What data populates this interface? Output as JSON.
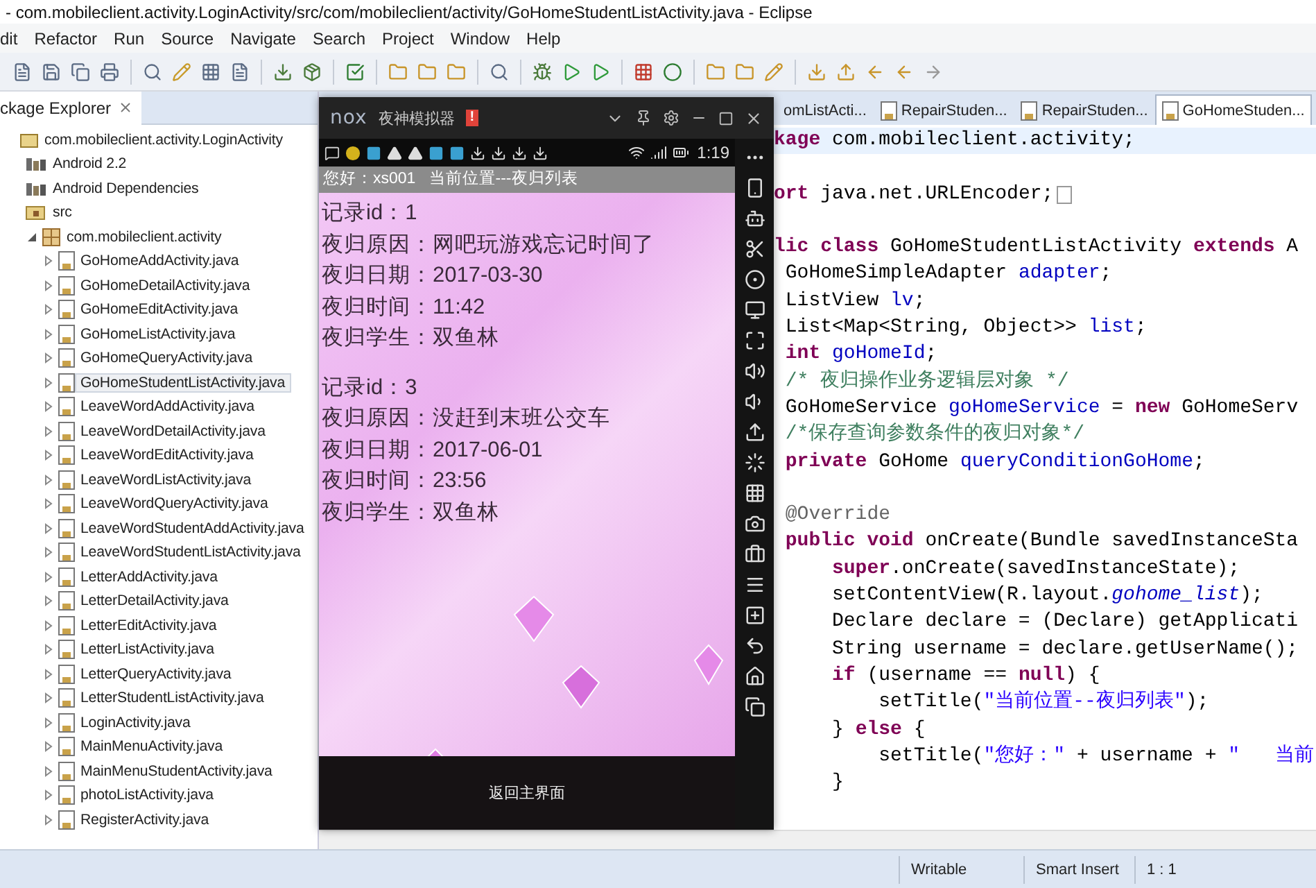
{
  "window": {
    "title": "- com.mobileclient.activity.LoginActivity/src/com/mobileclient/activity/GoHomeStudentListActivity.java - Eclipse"
  },
  "menu": [
    "dit",
    "Refactor",
    "Run",
    "Source",
    "Navigate",
    "Search",
    "Project",
    "Window",
    "Help"
  ],
  "package_explorer": {
    "title": "ckage Explorer",
    "tree": [
      {
        "label": "com.mobileclient.activity.LoginActivity",
        "kind": "project",
        "selected": false,
        "children": [
          {
            "label": "Android 2.2",
            "kind": "library",
            "selected": false
          },
          {
            "label": "Android Dependencies",
            "kind": "library",
            "selected": false
          },
          {
            "label": "src",
            "kind": "folder",
            "selected": false,
            "children": [
              {
                "label": "com.mobileclient.activity",
                "kind": "package",
                "expanded": true,
                "selected": false,
                "children": [
                  {
                    "label": "GoHomeAddActivity.java",
                    "kind": "file",
                    "expanded": false,
                    "selected": false
                  },
                  {
                    "label": "GoHomeDetailActivity.java",
                    "kind": "file",
                    "expanded": false,
                    "selected": false
                  },
                  {
                    "label": "GoHomeEditActivity.java",
                    "kind": "file",
                    "expanded": false,
                    "selected": false
                  },
                  {
                    "label": "GoHomeListActivity.java",
                    "kind": "file",
                    "expanded": false,
                    "selected": false
                  },
                  {
                    "label": "GoHomeQueryActivity.java",
                    "kind": "file",
                    "expanded": false,
                    "selected": false
                  },
                  {
                    "label": "GoHomeStudentListActivity.java",
                    "kind": "file",
                    "expanded": false,
                    "selected": true
                  },
                  {
                    "label": "LeaveWordAddActivity.java",
                    "kind": "file",
                    "expanded": false,
                    "selected": false
                  },
                  {
                    "label": "LeaveWordDetailActivity.java",
                    "kind": "file",
                    "expanded": false,
                    "selected": false
                  },
                  {
                    "label": "LeaveWordEditActivity.java",
                    "kind": "file",
                    "expanded": false,
                    "selected": false
                  },
                  {
                    "label": "LeaveWordListActivity.java",
                    "kind": "file",
                    "expanded": false,
                    "selected": false
                  },
                  {
                    "label": "LeaveWordQueryActivity.java",
                    "kind": "file",
                    "expanded": false,
                    "selected": false
                  },
                  {
                    "label": "LeaveWordStudentAddActivity.java",
                    "kind": "file",
                    "expanded": false,
                    "selected": false
                  },
                  {
                    "label": "LeaveWordStudentListActivity.java",
                    "kind": "file",
                    "expanded": false,
                    "selected": false
                  },
                  {
                    "label": "LetterAddActivity.java",
                    "kind": "file",
                    "expanded": false,
                    "selected": false
                  },
                  {
                    "label": "LetterDetailActivity.java",
                    "kind": "file",
                    "expanded": false,
                    "selected": false
                  },
                  {
                    "label": "LetterEditActivity.java",
                    "kind": "file",
                    "expanded": false,
                    "selected": false
                  },
                  {
                    "label": "LetterListActivity.java",
                    "kind": "file",
                    "expanded": false,
                    "selected": false
                  },
                  {
                    "label": "LetterQueryActivity.java",
                    "kind": "file",
                    "expanded": false,
                    "selected": false
                  },
                  {
                    "label": "LetterStudentListActivity.java",
                    "kind": "file",
                    "expanded": false,
                    "selected": false
                  },
                  {
                    "label": "LoginActivity.java",
                    "kind": "file",
                    "expanded": false,
                    "selected": false
                  },
                  {
                    "label": "MainMenuActivity.java",
                    "kind": "file",
                    "expanded": false,
                    "selected": false
                  },
                  {
                    "label": "MainMenuStudentActivity.java",
                    "kind": "file",
                    "expanded": false,
                    "selected": false
                  },
                  {
                    "label": "photoListActivity.java",
                    "kind": "file",
                    "expanded": false,
                    "selected": false
                  },
                  {
                    "label": "RegisterActivity.java",
                    "kind": "file",
                    "expanded": false,
                    "selected": false
                  }
                ]
              }
            ]
          }
        ]
      }
    ]
  },
  "editor": {
    "tabs": [
      {
        "label": "omListActi...",
        "selected": false
      },
      {
        "label": "RepairStuden...",
        "selected": false
      },
      {
        "label": "RepairStuden...",
        "selected": false
      },
      {
        "label": "GoHomeStuden...",
        "selected": true
      }
    ],
    "code_lines": [
      {
        "current": true,
        "segments": [
          {
            "text": "kage",
            "kind": "kw"
          },
          {
            "text": " com.mobileclient.activity;",
            "kind": "plain"
          }
        ]
      },
      {
        "blank_before": true,
        "folded": true,
        "segments": [
          {
            "text": "ort",
            "kind": "kw"
          },
          {
            "text": " java.net.URLEncoder;",
            "kind": "plain"
          }
        ]
      },
      {
        "blank_before": true,
        "segments": [
          {
            "text": "lic class",
            "kind": "kw"
          },
          {
            "text": " GoHomeStudentListActivity ",
            "kind": "plain"
          },
          {
            "text": "extends",
            "kind": "kw"
          },
          {
            "text": " A",
            "kind": "plain"
          }
        ]
      },
      {
        "segments": [
          {
            "text": " GoHomeSimpleAdapter ",
            "kind": "plain"
          },
          {
            "text": "adapter",
            "kind": "field"
          },
          {
            "text": ";",
            "kind": "plain"
          }
        ]
      },
      {
        "segments": [
          {
            "text": " ListView ",
            "kind": "plain"
          },
          {
            "text": "lv",
            "kind": "field"
          },
          {
            "text": ";",
            "kind": "plain"
          }
        ]
      },
      {
        "segments": [
          {
            "text": " List<Map<String, Object>> ",
            "kind": "plain"
          },
          {
            "text": "list",
            "kind": "field"
          },
          {
            "text": ";",
            "kind": "plain"
          }
        ]
      },
      {
        "segments": [
          {
            "text": " int",
            "kind": "kw"
          },
          {
            "text": " goHomeId",
            "kind": "field"
          },
          {
            "text": ";",
            "kind": "plain"
          }
        ]
      },
      {
        "segments": [
          {
            "text": " /* 夜归操作业务逻辑层对象 */",
            "kind": "comment"
          }
        ]
      },
      {
        "segments": [
          {
            "text": " GoHomeService ",
            "kind": "plain"
          },
          {
            "text": "goHomeService",
            "kind": "field"
          },
          {
            "text": " = ",
            "kind": "plain"
          },
          {
            "text": "new",
            "kind": "kw"
          },
          {
            "text": " GoHomeServ",
            "kind": "plain"
          }
        ]
      },
      {
        "segments": [
          {
            "text": " /*保存查询参数条件的夜归对象*/",
            "kind": "comment"
          }
        ]
      },
      {
        "segments": [
          {
            "text": " private",
            "kind": "kw"
          },
          {
            "text": " GoHome ",
            "kind": "plain"
          },
          {
            "text": "queryConditionGoHome",
            "kind": "field"
          },
          {
            "text": ";",
            "kind": "plain"
          }
        ]
      },
      {
        "blank_before": true,
        "segments": [
          {
            "text": " @Override",
            "kind": "annotation"
          }
        ]
      },
      {
        "segments": [
          {
            "text": " public void",
            "kind": "kw"
          },
          {
            "text": " onCreate(Bundle savedInstanceSta",
            "kind": "plain"
          }
        ]
      },
      {
        "segments": [
          {
            "text": "     super",
            "kind": "kw"
          },
          {
            "text": ".onCreate(savedInstanceState);",
            "kind": "plain"
          }
        ]
      },
      {
        "segments": [
          {
            "text": "     setContentView(R.layout.",
            "kind": "plain"
          },
          {
            "text": "gohome_list",
            "kind": "italic"
          },
          {
            "text": ");",
            "kind": "plain"
          }
        ]
      },
      {
        "segments": [
          {
            "text": "     Declare declare = (Declare) getApplicati",
            "kind": "plain"
          }
        ]
      },
      {
        "segments": [
          {
            "text": "     String username = declare.getUserName();",
            "kind": "plain"
          }
        ]
      },
      {
        "segments": [
          {
            "text": "     if",
            "kind": "kw"
          },
          {
            "text": " (username == ",
            "kind": "plain"
          },
          {
            "text": "null",
            "kind": "kw"
          },
          {
            "text": ") {",
            "kind": "plain"
          }
        ]
      },
      {
        "segments": [
          {
            "text": "         setTitle(",
            "kind": "plain"
          },
          {
            "text": "\"当前位置--夜归列表\"",
            "kind": "string"
          },
          {
            "text": ");",
            "kind": "plain"
          }
        ]
      },
      {
        "segments": [
          {
            "text": "     } ",
            "kind": "plain"
          },
          {
            "text": "else",
            "kind": "kw"
          },
          {
            "text": " {",
            "kind": "plain"
          }
        ]
      },
      {
        "segments": [
          {
            "text": "         setTitle(",
            "kind": "plain"
          },
          {
            "text": "\"您好：\"",
            "kind": "string"
          },
          {
            "text": " + username + ",
            "kind": "plain"
          },
          {
            "text": "\"   当前",
            "kind": "string"
          }
        ]
      },
      {
        "segments": [
          {
            "text": "     }",
            "kind": "plain"
          }
        ]
      }
    ]
  },
  "status_bar": [
    "Writable",
    "Smart Insert",
    "1 : 1"
  ],
  "emulator": {
    "logo": "nox",
    "title": "夜神模拟器",
    "badge": "!",
    "time": "1:19",
    "app_title": "您好：xs001   当前位置---夜归列表",
    "records": [
      {
        "lines": [
          "记录id：1",
          "夜归原因：网吧玩游戏忘记时间了",
          "夜归日期：2017-03-30",
          "夜归时间：11:42",
          "夜归学生：双鱼林"
        ]
      },
      {
        "lines": [
          "记录id：3",
          "夜归原因：没赶到末班公交车",
          "夜归日期：2017-06-01",
          "夜归时间：23:56",
          "夜归学生：双鱼林"
        ]
      }
    ],
    "back_button": "返回主界面"
  }
}
